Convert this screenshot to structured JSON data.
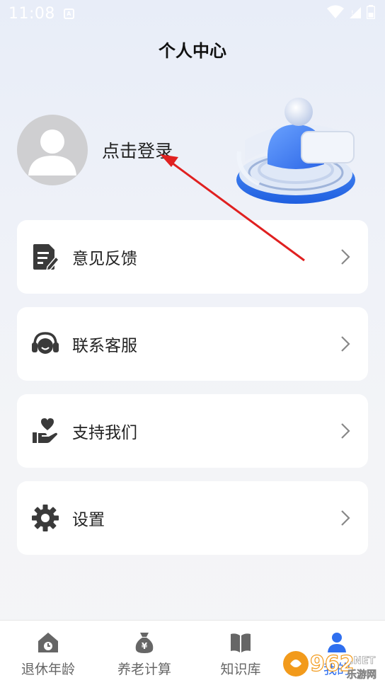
{
  "status_bar": {
    "time": "11:08",
    "notif_glyph": "A"
  },
  "header": {
    "title": "个人中心"
  },
  "profile": {
    "login_label": "点击登录"
  },
  "menu": [
    {
      "id": "feedback",
      "label": "意见反馈",
      "icon": "feedback-icon"
    },
    {
      "id": "contact",
      "label": "联系客服",
      "icon": "headset-icon"
    },
    {
      "id": "support",
      "label": "支持我们",
      "icon": "heart-hand-icon"
    },
    {
      "id": "settings",
      "label": "设置",
      "icon": "gear-icon"
    }
  ],
  "tabs": [
    {
      "label": "退休年龄",
      "icon": "house-age-icon",
      "active": false
    },
    {
      "label": "养老计算",
      "icon": "money-bag-icon",
      "active": false
    },
    {
      "label": "知识库",
      "icon": "book-icon",
      "active": false
    },
    {
      "label": "我的",
      "icon": "person-icon",
      "active": true
    }
  ],
  "watermark": {
    "text": "962.NET",
    "subtext": "乐游网"
  },
  "colors": {
    "accent": "#2f6fef",
    "card": "#ffffff",
    "icon": "#3a3a3a",
    "annotation": "#e02020"
  }
}
